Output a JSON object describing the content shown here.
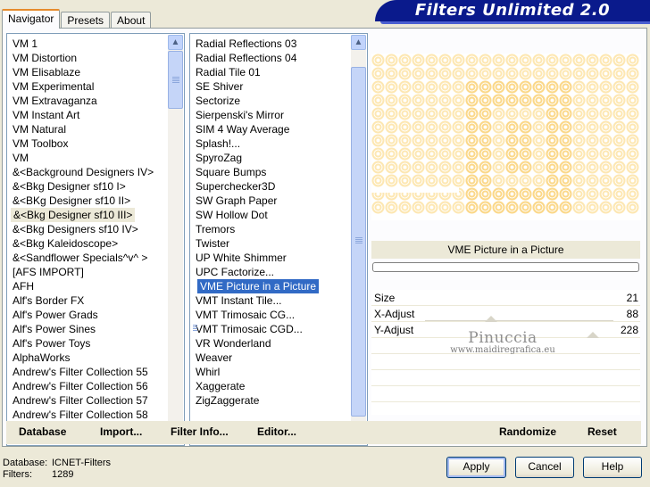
{
  "title": "Filters Unlimited 2.0",
  "tabs": [
    "Navigator",
    "Presets",
    "About"
  ],
  "categories": [
    "VM 1",
    "VM Distortion",
    "VM Elisablaze",
    "VM Experimental",
    "VM Extravaganza",
    "VM Instant Art",
    "VM Natural",
    "VM Toolbox",
    "VM",
    "&<Background Designers IV>",
    "&<Bkg Designer sf10 I>",
    "&<BKg Designer sf10 II>",
    "&<Bkg Designer sf10 III>",
    "&<Bkg Designers sf10 IV>",
    "&<Bkg Kaleidoscope>",
    "&<Sandflower Specials^v^ >",
    "[AFS IMPORT]",
    "AFH",
    "Alf's Border FX",
    "Alf's Power Grads",
    "Alf's Power Sines",
    "Alf's Power Toys",
    "AlphaWorks",
    "Andrew's Filter Collection 55",
    "Andrew's Filter Collection 56",
    "Andrew's Filter Collection 57",
    "Andrew's Filter Collection 58"
  ],
  "highlighted_category": "&<Bkg Designer sf10 III>",
  "filters": [
    "Radial Reflections 03",
    "Radial Reflections 04",
    "Radial Tile 01",
    "SE Shiver",
    "Sectorize",
    "Sierpenski's Mirror",
    "SIM 4 Way Average",
    "Splash!...",
    "SpyroZag",
    "Square Bumps",
    "Superchecker3D",
    "SW Graph Paper",
    "SW Hollow Dot",
    "Tremors",
    "Twister",
    "UP White Shimmer",
    "UPC Factorize...",
    "VME Picture in a Picture",
    "VMT Instant Tile...",
    "VMT Trimosaic CG...",
    "VMT Trimosaic CGD...",
    "VR Wonderland",
    "Weaver",
    "Whirl",
    "Xaggerate",
    "ZigZaggerate"
  ],
  "selected_filter": "VME Picture in a Picture",
  "preview_colors": {
    "base": "#fef6df",
    "ring": "#fbd889",
    "ring_light": "#fde7b2"
  },
  "filter_name": "VME Picture in a Picture",
  "params": [
    {
      "label": "Size",
      "value": "21",
      "level": 0.08
    },
    {
      "label": "X-Adjust",
      "value": "88",
      "level": 0.35
    },
    {
      "label": "Y-Adjust",
      "value": "228",
      "level": 0.89
    }
  ],
  "watermark": {
    "name": "Pinuccia",
    "site": "www.maidiregrafica.eu"
  },
  "commands": {
    "database": "Database",
    "import": "Import...",
    "filter_info": "Filter Info...",
    "editor": "Editor...",
    "randomize": "Randomize",
    "reset": "Reset"
  },
  "footer": {
    "database_label": "Database:",
    "database_value": "ICNET-Filters",
    "filters_label": "Filters:",
    "filters_value": "1289"
  },
  "buttons": {
    "apply": "Apply",
    "cancel": "Cancel",
    "help": "Help"
  }
}
